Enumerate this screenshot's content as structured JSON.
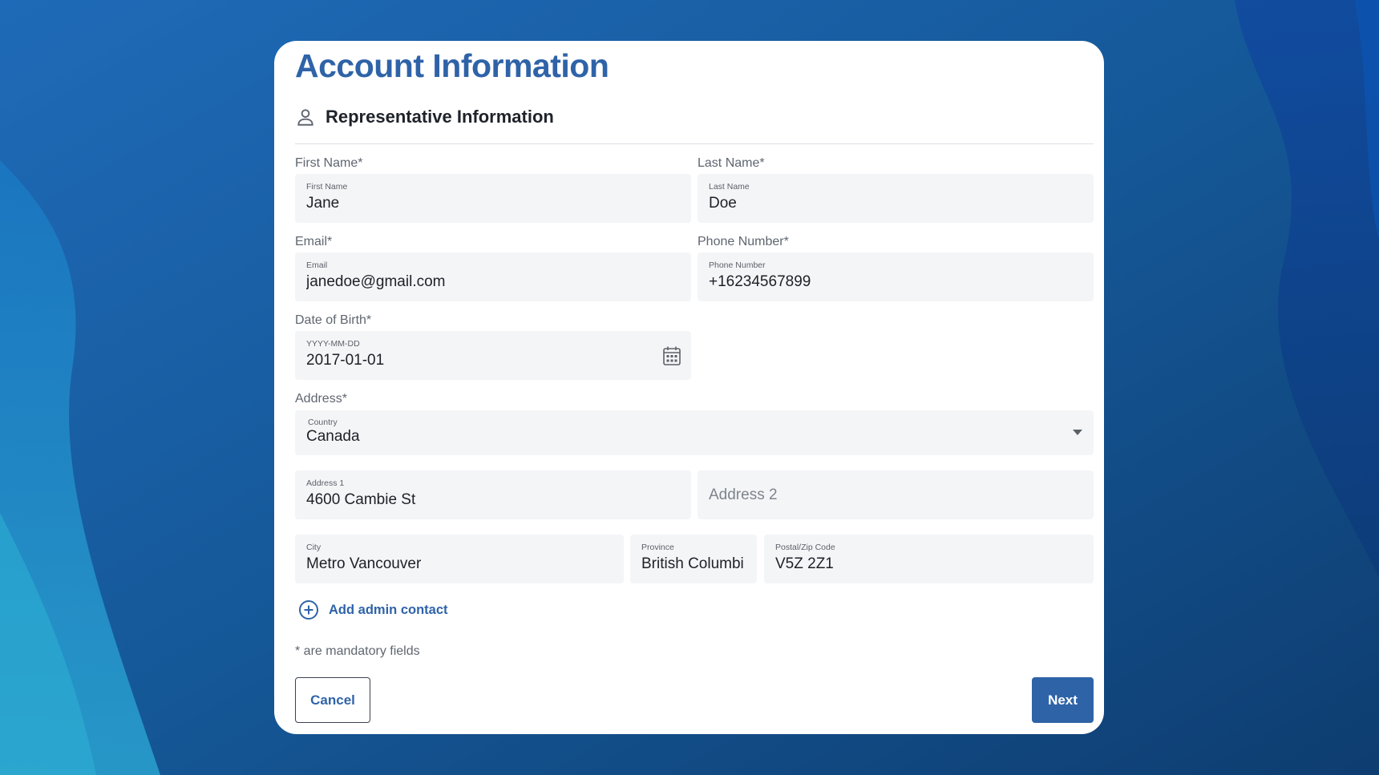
{
  "page": {
    "title": "Account Information",
    "section_title": "Representative Information",
    "section_icon": "person-icon",
    "colors": {
      "accent": "#2f63a8",
      "field_bg": "#f4f5f7",
      "background": "#1a5aa0"
    }
  },
  "form": {
    "first_name": {
      "label": "First Name*",
      "field_label": "First Name",
      "value": "Jane"
    },
    "last_name": {
      "label": "Last Name*",
      "field_label": "Last Name",
      "value": "Doe"
    },
    "email": {
      "label": "Email*",
      "field_label": "Email",
      "value": "janedoe@gmail.com"
    },
    "phone": {
      "label": "Phone Number*",
      "field_label": "Phone Number",
      "value": "+16234567899"
    },
    "dob": {
      "label": "Date of Birth*",
      "field_label": "YYYY-MM-DD",
      "value": "2017-01-01",
      "icon": "calendar-icon"
    },
    "address": {
      "label": "Address*",
      "country": {
        "field_label": "Country",
        "value": "Canada"
      },
      "address1": {
        "field_label": "Address 1",
        "value": "4600 Cambie St"
      },
      "address2": {
        "placeholder": "Address 2"
      },
      "city": {
        "field_label": "City",
        "value": "Metro Vancouver"
      },
      "province": {
        "field_label": "Province",
        "value": "British Columbi"
      },
      "postal": {
        "field_label": "Postal/Zip Code",
        "value": "V5Z 2Z1"
      }
    }
  },
  "actions": {
    "add_contact_label": "Add admin contact",
    "mandatory_note": "* are mandatory fields",
    "cancel_label": "Cancel",
    "next_label": "Next"
  }
}
